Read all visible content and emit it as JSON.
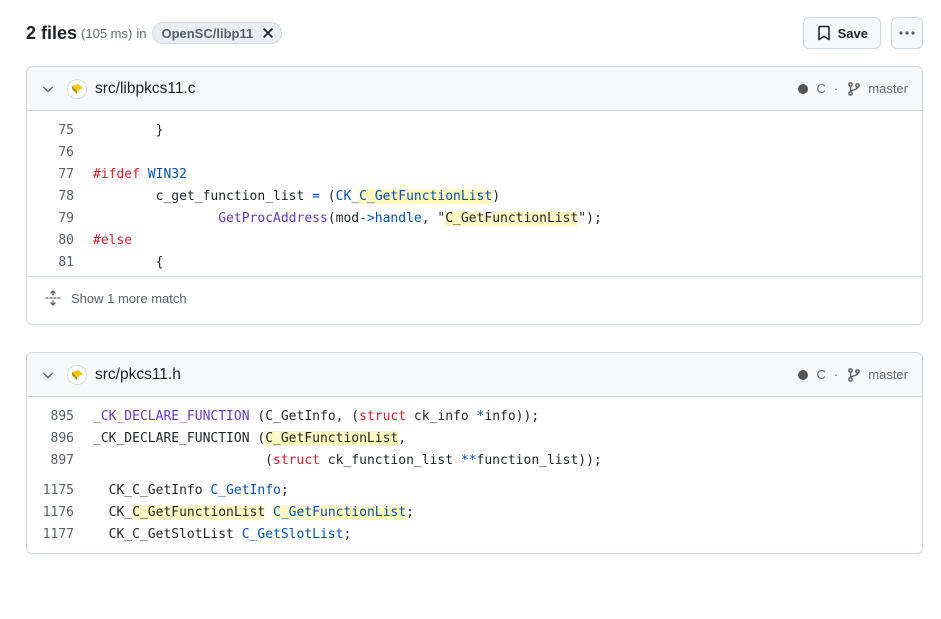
{
  "header": {
    "title": "2 files",
    "timing": "(105 ms)",
    "in_text": "in",
    "repo": "OpenSC/libp11",
    "save_label": "Save"
  },
  "results": [
    {
      "path": "src/libpkcs11.c",
      "language": "C",
      "separator": "·",
      "branch": "master",
      "more_match": "Show 1 more match"
    },
    {
      "path": "src/pkcs11.h",
      "language": "C",
      "separator": "·",
      "branch": "master"
    }
  ],
  "icons": {
    "chevron": "chevron-down-icon",
    "close": "x-icon",
    "bookmark": "bookmark-icon",
    "kebab": "kebab-horizontal-icon",
    "branch": "git-branch-icon",
    "file": "file-language-icon",
    "unfold": "unfold-icon"
  },
  "code1": {
    "l75": {
      "n": "75",
      "a": "        }"
    },
    "l76": {
      "n": "76"
    },
    "l77": {
      "n": "77",
      "a": "#ifdef",
      "b": " ",
      "c": "WIN32"
    },
    "l78": {
      "n": "78",
      "a": "        c_get_function_list ",
      "b": "=",
      "c": " (",
      "d": "CK_",
      "e": "C_GetFunctionList",
      "f": ")"
    },
    "l79": {
      "n": "79",
      "a": "                ",
      "b": "GetProcAddress",
      "c": "(mod",
      "d": "->",
      "e": "handle",
      "f": ", \"",
      "g": "C_GetFunctionList",
      "h": "\");"
    },
    "l80": {
      "n": "80",
      "a": "#else"
    },
    "l81": {
      "n": "81",
      "a": "        {"
    }
  },
  "code2": {
    "l895": {
      "n": "895",
      "a": "_CK_DECLARE_FUNCTION",
      "b": " (C_GetInfo, (",
      "c": "struct",
      "d": " ck_info ",
      "e": "*",
      "f": "info));"
    },
    "l896": {
      "n": "896",
      "a": "_CK_DECLARE_FUNCTION (",
      "b": "C_GetFunctionList",
      "c": ","
    },
    "l897": {
      "n": "897",
      "a": "                      (",
      "b": "struct",
      "c": " ck_function_list ",
      "d": "**",
      "e": "function_list));"
    },
    "l1175": {
      "n": "1175",
      "a": "  CK_C_GetInfo ",
      "b": "C_GetInfo",
      "c": ";"
    },
    "l1176": {
      "n": "1176",
      "a": "  CK_",
      "b": "C_GetFunctionList",
      "c": " ",
      "d": "C_GetFunctionList",
      "e": ";"
    },
    "l1177": {
      "n": "1177",
      "a": "  CK_C_GetSlotList ",
      "b": "C_GetSlotList",
      "c": ";"
    }
  }
}
